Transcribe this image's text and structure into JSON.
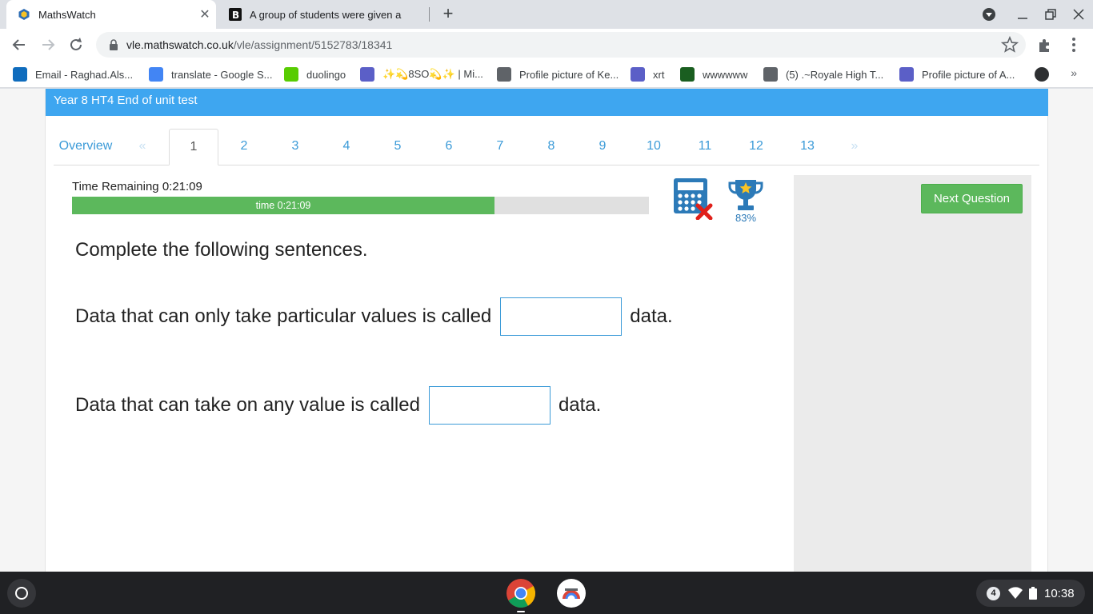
{
  "browser": {
    "tabs": [
      {
        "title": "MathsWatch",
        "active": true
      },
      {
        "title": "A group of students were given a",
        "active": false
      }
    ],
    "url_host": "vle.mathswatch.co.uk",
    "url_path": "/vle/assignment/5152783/18341",
    "bookmarks": [
      {
        "label": "Email - Raghad.Als...",
        "icon": "outlook-icon",
        "color": "#0f6cbd"
      },
      {
        "label": "translate - Google S...",
        "icon": "google-icon",
        "color": "#4285f4"
      },
      {
        "label": "duolingo",
        "icon": "duolingo-icon",
        "color": "#58cc02"
      },
      {
        "label": "✨💫8SO💫✨ | Mi...",
        "icon": "teams-icon",
        "color": "#5b5fc7"
      },
      {
        "label": "Profile picture of Ke...",
        "icon": "globe-icon",
        "color": "#5f6368"
      },
      {
        "label": "xrt",
        "icon": "teams-icon",
        "color": "#5b5fc7"
      },
      {
        "label": "wwwwww",
        "icon": "image-icon",
        "color": "#1a5e20"
      },
      {
        "label": "(5) .~Royale High T...",
        "icon": "roblox-icon",
        "color": "#5f6368"
      },
      {
        "label": "Profile picture of A...",
        "icon": "teams-icon",
        "color": "#5b5fc7"
      }
    ]
  },
  "assignment": {
    "title": "Year 8 HT4 End of unit test",
    "tabs": [
      "Overview",
      "«",
      "1",
      "2",
      "3",
      "4",
      "5",
      "6",
      "7",
      "8",
      "9",
      "10",
      "11",
      "12",
      "13",
      "»"
    ],
    "active_tab": "1",
    "timer_label": "Time Remaining 0:21:09",
    "timer_bar_text": "time 0:21:09",
    "timer_fraction": 0.733,
    "score": "83%",
    "next_button": "Next Question",
    "instruction": "Complete the following sentences.",
    "questions": [
      {
        "before": "Data that can only take particular values is called",
        "answer": "",
        "after": "data."
      },
      {
        "before": "Data that can take on any value is called",
        "answer": "",
        "after": "data."
      }
    ]
  },
  "system": {
    "notification_count": "4",
    "clock": "10:38"
  },
  "colors": {
    "banner": "#3ea6f0",
    "link": "#3c9bd8",
    "progress": "#5cb85c",
    "button": "#5cb85c",
    "calculator": "#2c7ab8",
    "calculator_cross": "#e0201a",
    "trophy": "#2c7ab8"
  }
}
